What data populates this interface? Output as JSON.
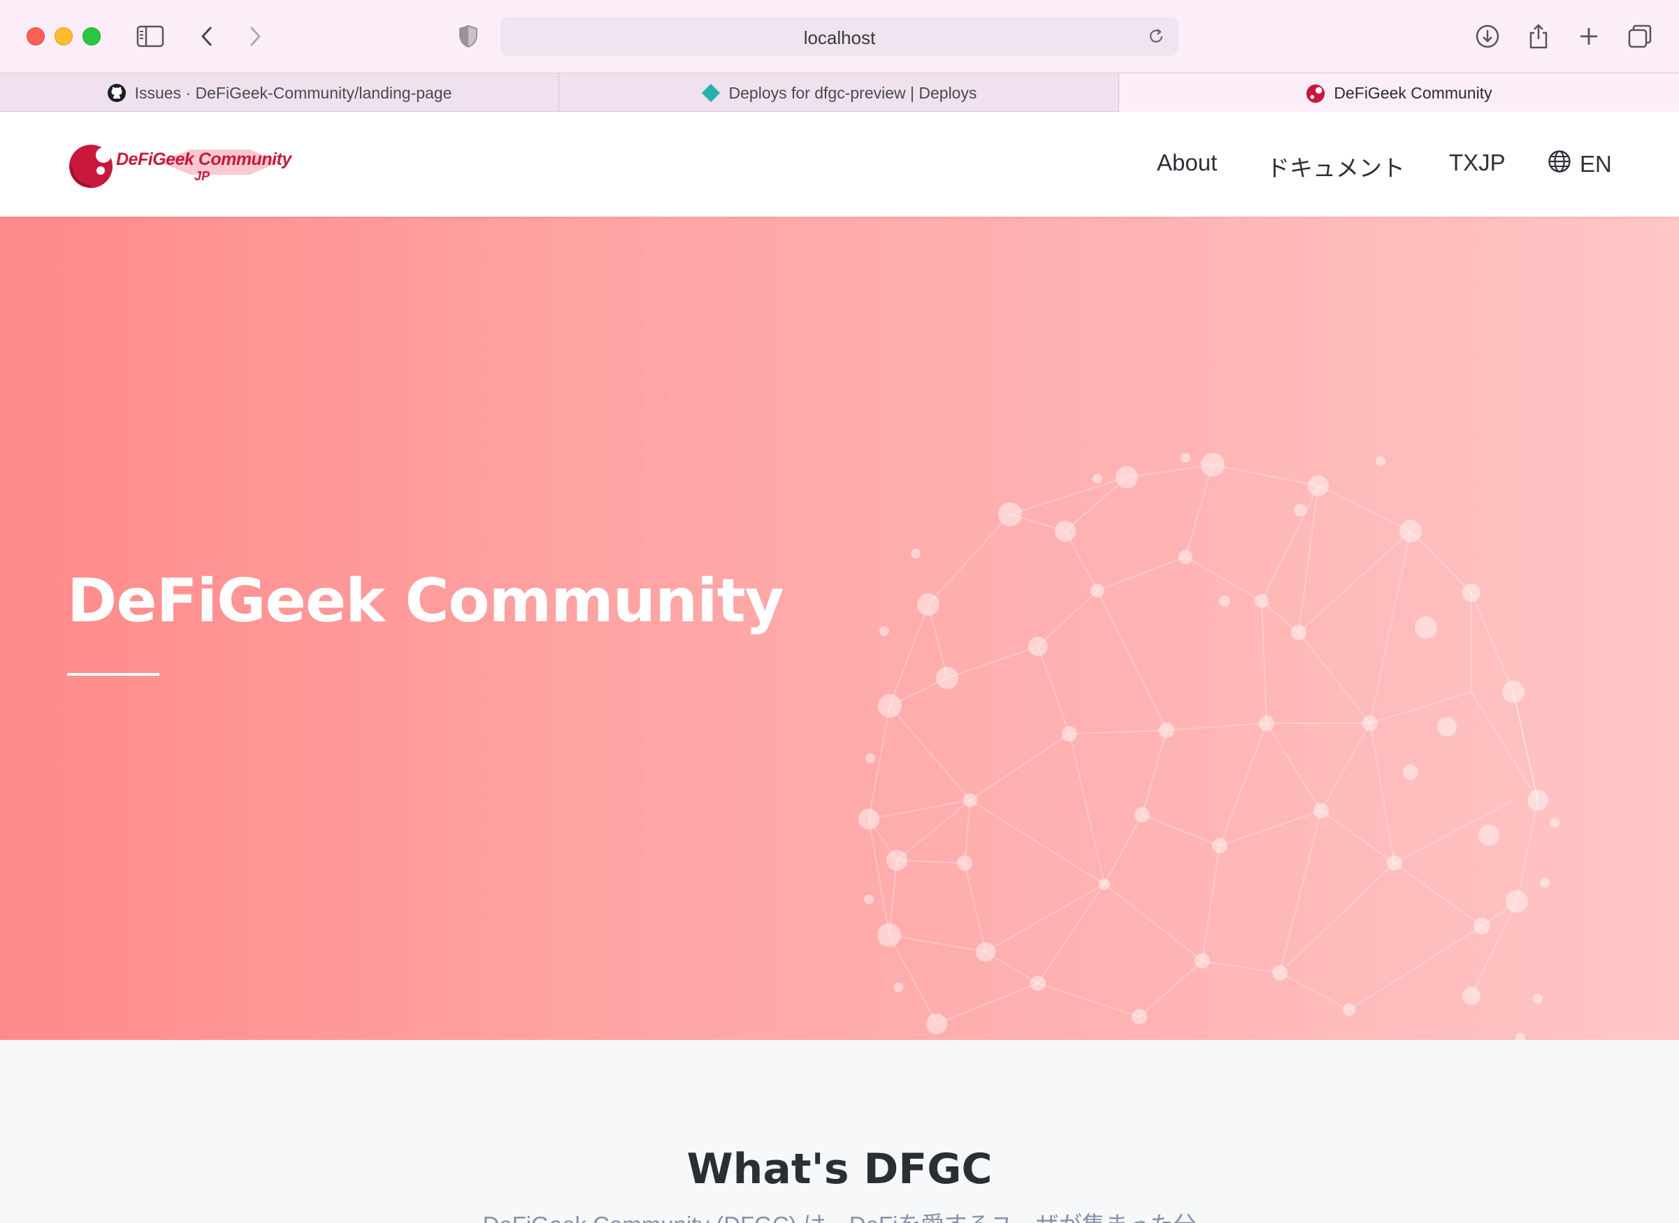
{
  "browser": {
    "url": "localhost",
    "tabs": [
      {
        "label": "Issues · DeFiGeek-Community/landing-page",
        "icon": "github-icon"
      },
      {
        "label": "Deploys for dfgc-preview | Deploys",
        "icon": "netlify-icon"
      },
      {
        "label": "DeFiGeek Community",
        "icon": "dfgc-favicon",
        "active": true
      }
    ]
  },
  "header": {
    "logo_text": "DeFiGeek Community",
    "logo_sub": "JP",
    "nav": {
      "about": "About",
      "docs": "ドキュメント",
      "txjp": "TXJP",
      "lang": "EN"
    }
  },
  "hero": {
    "title": "DeFiGeek Community"
  },
  "section": {
    "title": "What's DFGC",
    "text": "DeFiGeek Community (DFGC) は、DeFiを愛するユーザが集まった分"
  },
  "colors": {
    "brand": "#c8193c",
    "hero_start": "#ff8a8a",
    "hero_end": "#ffc6c6"
  }
}
